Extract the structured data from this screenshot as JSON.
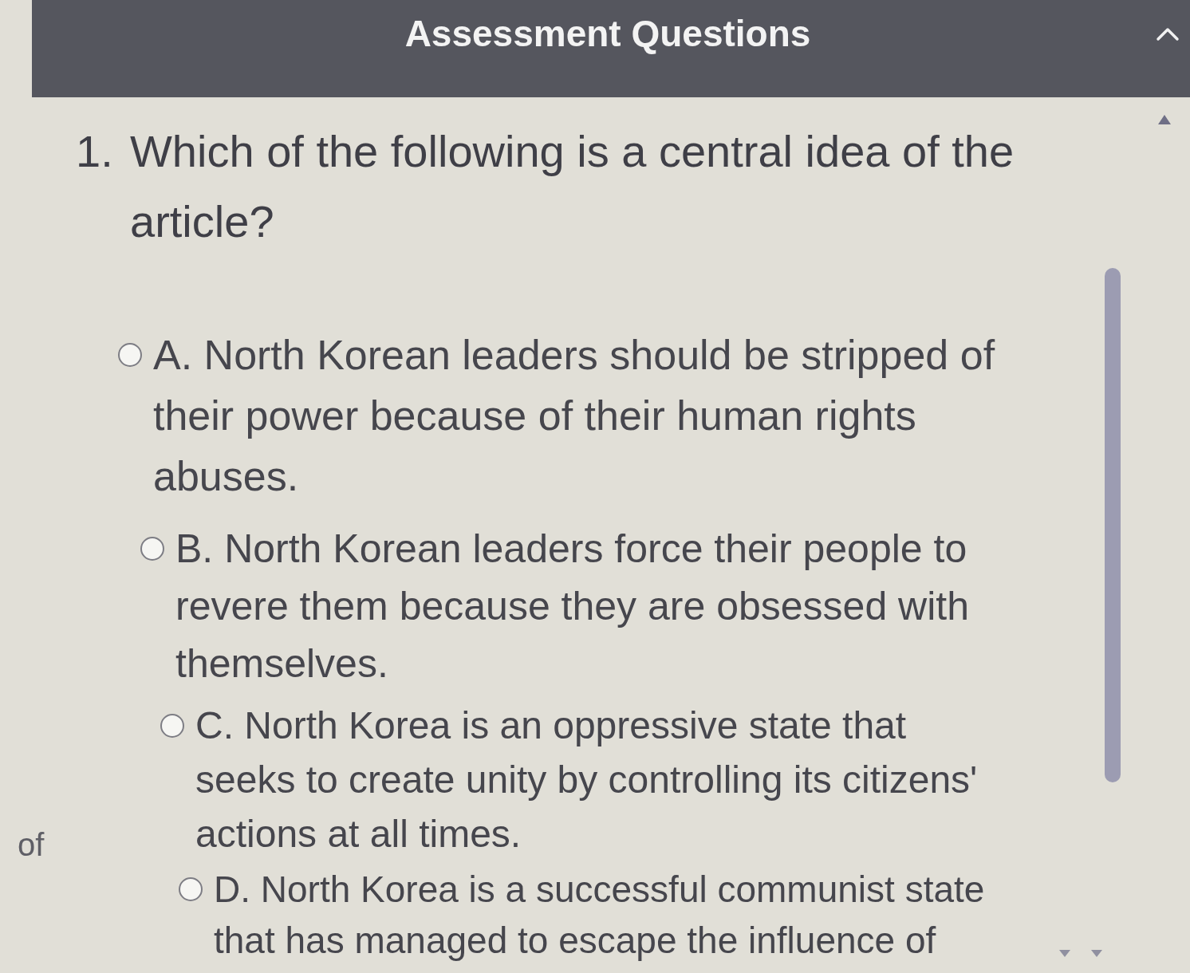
{
  "header": {
    "title": "Assessment Questions",
    "expanded": true
  },
  "left_pane": {
    "text_fragment": "of"
  },
  "question": {
    "number": "1.",
    "text": "Which of the following is a central idea of the article?",
    "options": [
      {
        "text": "A. North Korean leaders should be stripped of their power because of their human rights abuses.",
        "selected": false
      },
      {
        "text": "B. North Korean leaders force their people to revere them because they are obsessed with themselves.",
        "selected": false
      },
      {
        "text": "C. North Korea is an oppressive state that seeks to create unity by controlling its citizens' actions at all times.",
        "selected": false
      },
      {
        "text": "D. North Korea is a successful communist state that has managed to escape the influence of",
        "selected": false
      }
    ]
  }
}
